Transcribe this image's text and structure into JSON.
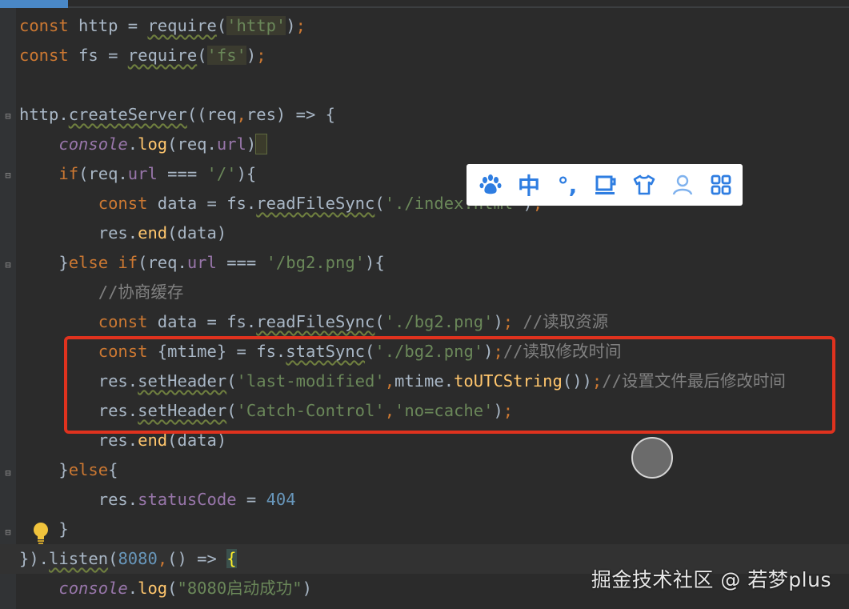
{
  "editor": {
    "lines": [
      "const http = require('http');",
      "const fs = require('fs');",
      "",
      "http.createServer((req,res) => {",
      "    console.log(req.url)",
      "    if(req.url === '/'){",
      "        const data = fs.readFileSync('./index.html');",
      "        res.end(data)",
      "    }else if(req.url === '/bg2.png'){",
      "        //协商缓存",
      "        const data = fs.readFileSync('./bg2.png'); //读取资源",
      "        const {mtime} = fs.statSync('./bg2.png');//读取修改时间",
      "        res.setHeader('last-modified',mtime.toUTCString());//设置文件最后修改时间",
      "        res.setHeader('Catch-Control','no=cache');",
      "        res.end(data)",
      "    }else{",
      "        res.statusCode = 404",
      "    }",
      "}).listen(8080,() => {",
      "    console.log(\"8080启动成功\")"
    ]
  },
  "ime_toolbar": {
    "items": [
      {
        "icon": "paw-icon"
      },
      {
        "label": "中"
      },
      {
        "label": "°,"
      },
      {
        "icon": "cup-icon"
      },
      {
        "icon": "shirt-icon"
      },
      {
        "icon": "user-icon"
      },
      {
        "icon": "grid-icon"
      }
    ]
  },
  "watermark": "掘金技术社区 @ 若梦plus",
  "colors": {
    "keyword": "#cc7832",
    "string": "#6a8759",
    "number": "#6897bb",
    "function": "#ffc66d",
    "field": "#9876aa",
    "comment": "#808080",
    "highlight_box": "#e0321e",
    "ime_accent": "#2e7de1"
  }
}
